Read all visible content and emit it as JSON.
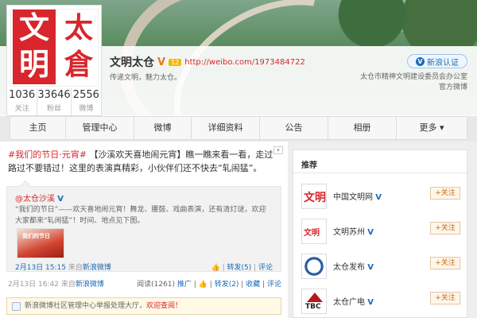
{
  "profile": {
    "name": "文明太仓",
    "level": "12",
    "url": "http://weibo.com/1973484722",
    "bio": "传递文明，魅力太仓。",
    "avatar_chars": [
      "文",
      "明",
      "太",
      "倉"
    ],
    "stats": [
      {
        "num": "1036",
        "label": "关注"
      },
      {
        "num": "33646",
        "label": "粉丝"
      },
      {
        "num": "2556",
        "label": "微博"
      }
    ],
    "verify_label": "新浪认证",
    "org_line1": "太仓市精神文明建设委员会办公室",
    "org_line2": "官方微博"
  },
  "nav": [
    "主页",
    "管理中心",
    "微博",
    "详细资料",
    "公告",
    "相册",
    "更多"
  ],
  "post": {
    "hashtag": "#我们的节日·元宵#",
    "text": "【沙溪欢天喜地闹元宵】瞧一瞧来看一看，走过路过不要错过！这里的表演真精彩，小伙伴们还不快去“轧闹猛”。",
    "repost": {
      "author": "@太仓沙溪",
      "text": "“我们的节日”——欢天喜地闹元宵！舞龙、腰鼓、戏曲表演，还有清灯谜，欢迎大家都来“轧闹猛”！时间、地点见下图。",
      "thumb_text": "我们的节日",
      "time": "2月13日 15:15",
      "source_prefix": "来自",
      "source": "新浪微博",
      "repost_label": "转发(5)",
      "comment_label": "评论"
    },
    "time": "2月13日 16:42",
    "source_prefix": "来自",
    "source": "新浪微博",
    "read_label": "阅读(1261)",
    "promote_label": "推广",
    "repost_label": "转发(2)",
    "fav_label": "收藏",
    "comment_label": "评论"
  },
  "notice": {
    "text": "新浪微博社区管理中心举报处理大厅，",
    "highlight": "欢迎查阅！"
  },
  "sidebar": {
    "title": "推荐",
    "follow_label": "+关注",
    "items": [
      {
        "name": "中国文明网",
        "logo_text": "文明"
      },
      {
        "name": "文明苏州",
        "logo_text": "文明"
      },
      {
        "name": "太仓发布"
      },
      {
        "name": "太仓广电",
        "logo_text": "TBC"
      }
    ]
  }
}
